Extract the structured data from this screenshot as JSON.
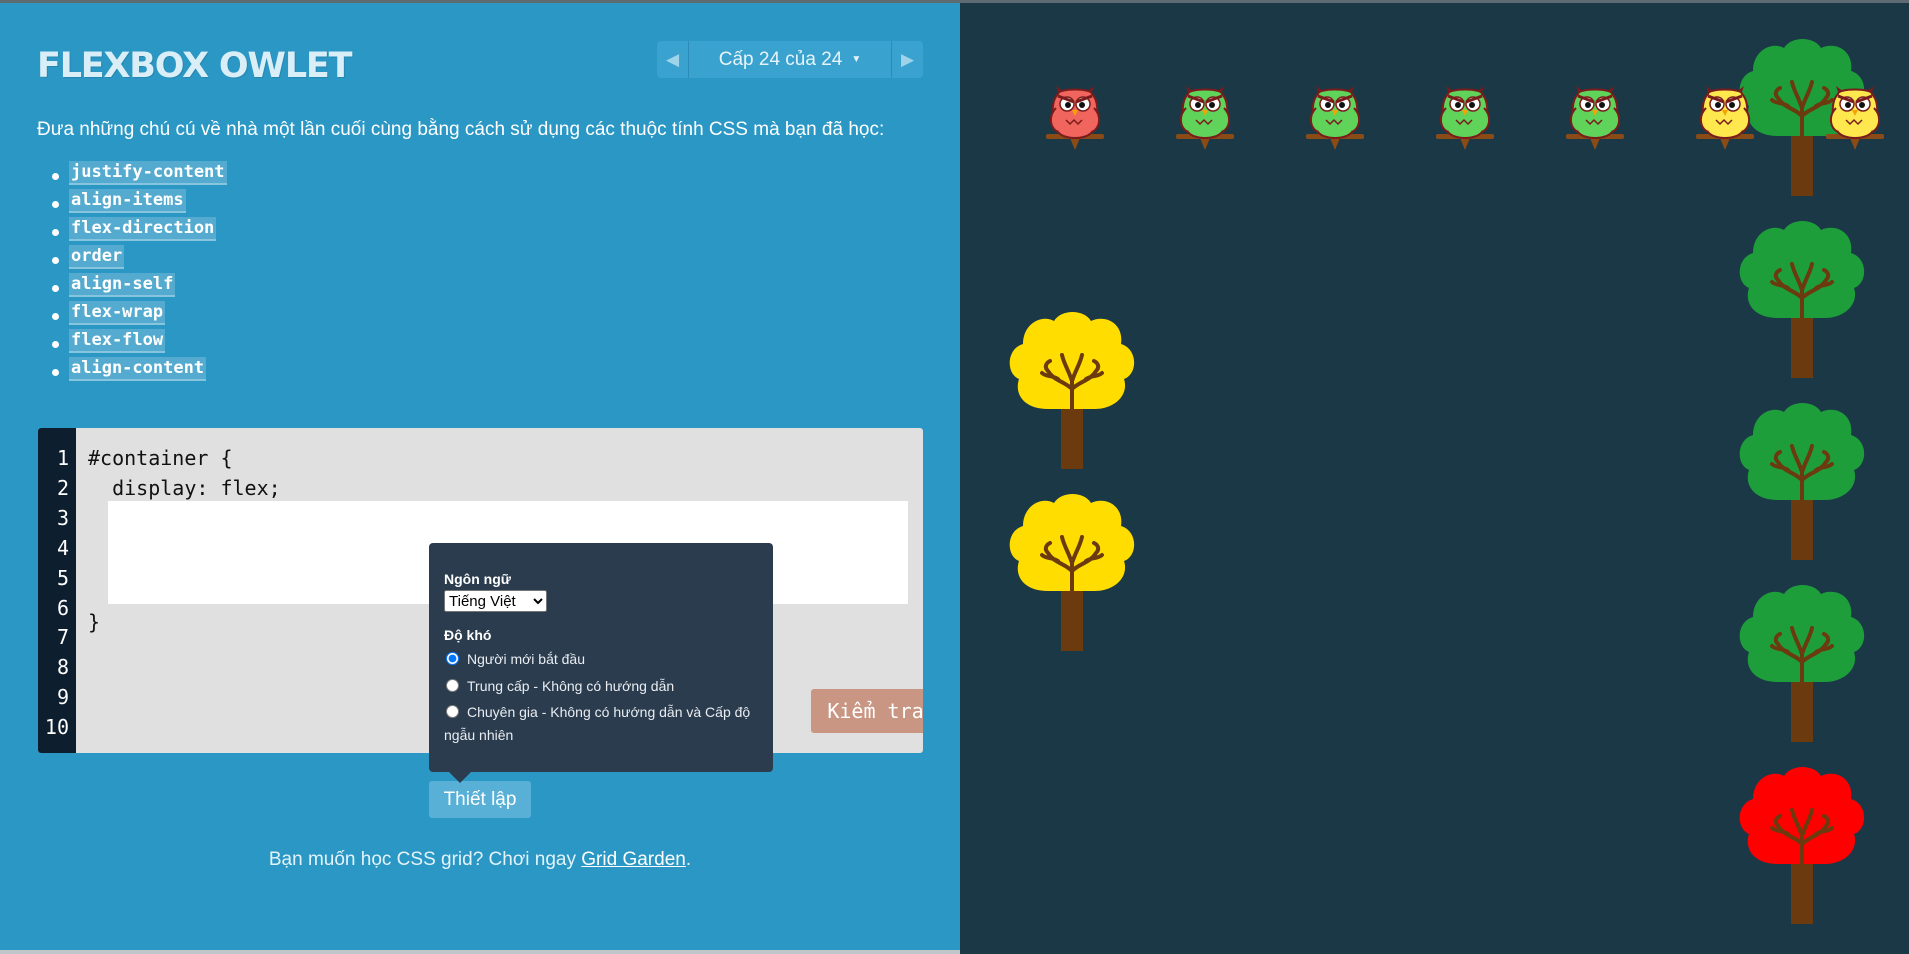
{
  "game": {
    "title": "FLEXBOX OWLET",
    "level_label": "Cấp 24 của 24",
    "instructions": "Đưa những chú cú về nhà một lần cuối cùng bằng cách sử dụng các thuộc tính CSS mà bạn đã học:",
    "properties": [
      "justify-content",
      "align-items",
      "flex-direction",
      "order",
      "align-self",
      "flex-wrap",
      "flex-flow",
      "align-content"
    ]
  },
  "editor": {
    "line_numbers": [
      "1",
      "2",
      "3",
      "4",
      "5",
      "6",
      "7",
      "8",
      "9",
      "10"
    ],
    "line1": "#container {",
    "line2": "  display: flex;",
    "closing": "}",
    "input_value": "",
    "check_label": "Kiểm tra"
  },
  "settings": {
    "language_label": "Ngôn ngữ",
    "language_selected": "Tiếng Việt",
    "difficulty_label": "Độ khó",
    "options": [
      "Người mới bắt đầu",
      "Trung cấp - Không có hướng dẫn",
      "Chuyên gia - Không có hướng dẫn và Cấp độ ngẫu nhiên"
    ],
    "selected_option": 0,
    "button_label": "Thiết lập"
  },
  "footer": {
    "text": "Bạn muốn học CSS grid? Chơi ngay ",
    "link": "Grid Garden",
    "end": "."
  },
  "colors": {
    "left_panel": "#2a97c4",
    "board": "#1b3847",
    "tree_green": "#1d9e3a",
    "tree_yellow": "#ffdd00",
    "tree_red": "#ff0000",
    "owl_red": "#f0665e",
    "owl_green": "#5fd35a",
    "owl_yellow": "#ffe84d"
  },
  "owls": [
    "red",
    "green",
    "green",
    "green",
    "green",
    "yellow",
    "yellow"
  ],
  "trees": [
    "green",
    "green",
    "green",
    "green",
    "red",
    "yellow",
    "yellow"
  ]
}
